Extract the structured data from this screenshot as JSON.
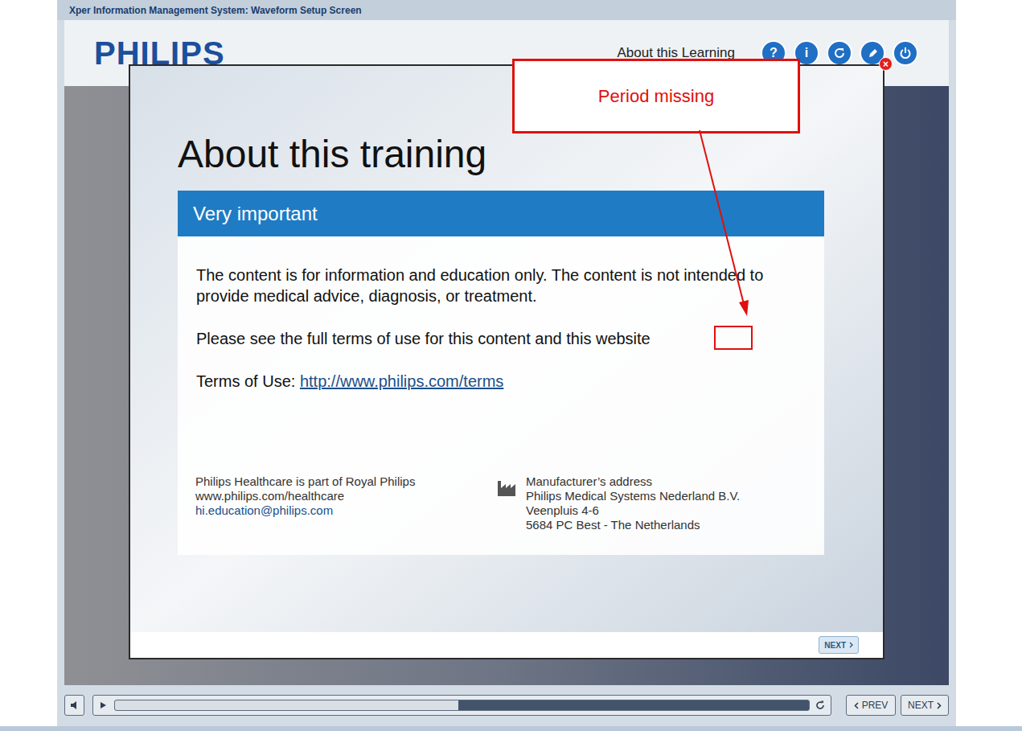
{
  "window": {
    "title": "Xper Information Management System: Waveform Setup Screen"
  },
  "header": {
    "logo": "PHILIPS",
    "link": "About this Learning",
    "help_label": "?",
    "info_label": "i"
  },
  "dialog": {
    "close": "×",
    "title": "About this training",
    "section": "Very important",
    "paragraphs": [
      "The content is for information and education only. The content is not intended to provide medical advice, diagnosis, or treatment.",
      "Please see the full terms of use for this content and this website"
    ],
    "terms_label": "Terms of Use: ",
    "terms_link": "http://www.philips.com/terms",
    "footer_left": [
      {
        "text": "Philips Healthcare is part of Royal Philips",
        "link": false
      },
      {
        "text": "www.philips.com/healthcare",
        "link": false
      },
      {
        "text": "hi.education@philips.com",
        "link": true
      }
    ],
    "footer_right": [
      "Manufacturer’s address",
      "Philips Medical Systems Nederland B.V.",
      "Veenpluis 4-6",
      "5684 PC Best - The Netherlands"
    ],
    "next": "NEXT"
  },
  "annotation": {
    "text": "Period missing"
  },
  "player": {
    "level": 0.495,
    "prev": "PREV",
    "next": "NEXT"
  }
}
